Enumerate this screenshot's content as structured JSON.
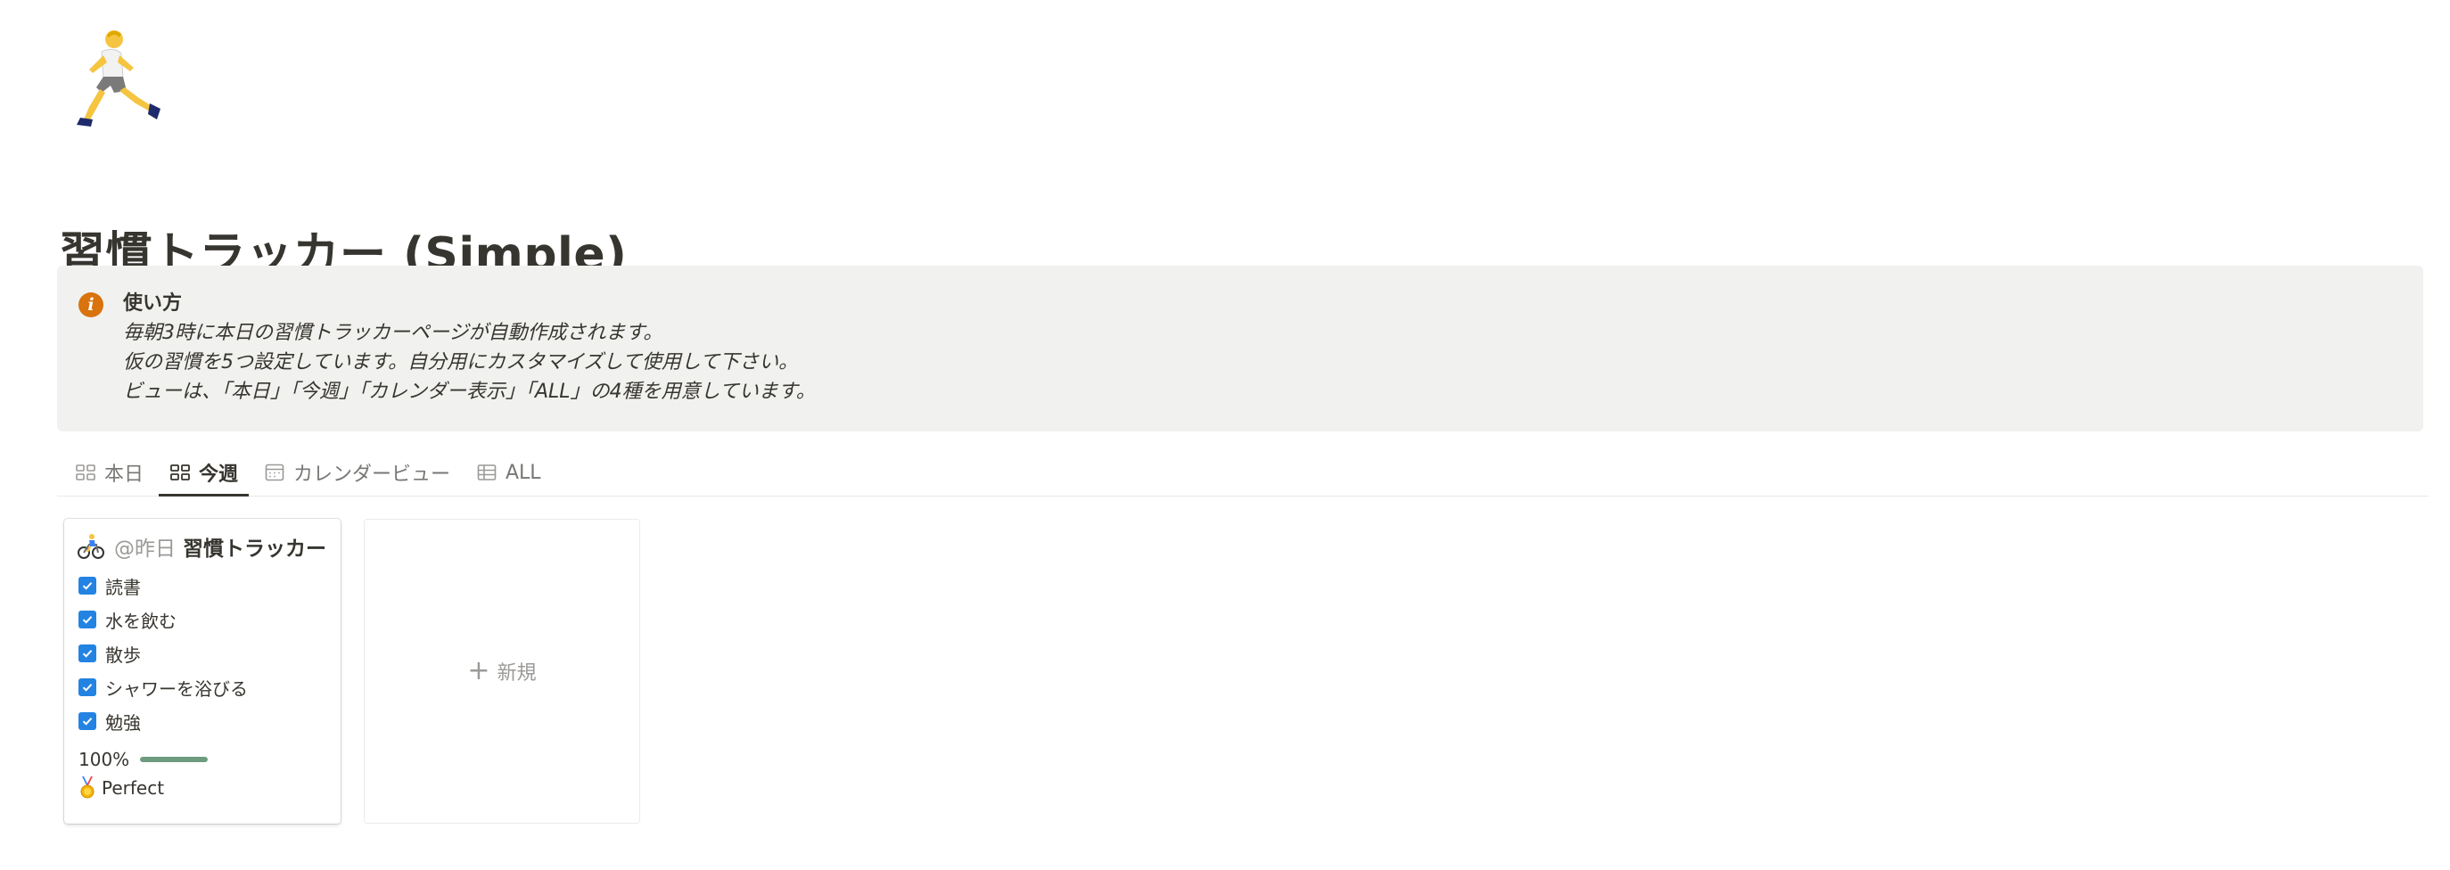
{
  "page": {
    "icon": "running-person-icon",
    "title": "習慣トラッカー (Simple)"
  },
  "callout": {
    "icon": "info-icon",
    "icon_color": "#d9730d",
    "heading": "使い方",
    "lines": [
      "毎朝3時に本日の習慣トラッカーページが自動作成されます。",
      "仮の習慣を5つ設定しています。自分用にカスタマイズして使用して下さい。",
      "ビューは、「本日」「今週」「カレンダー表示」「ALL」の4種を用意しています。"
    ]
  },
  "tabs": [
    {
      "label": "本日",
      "icon": "gallery-icon",
      "active": false
    },
    {
      "label": "今週",
      "icon": "gallery-icon",
      "active": true
    },
    {
      "label": "カレンダービュー",
      "icon": "calendar-icon",
      "active": false
    },
    {
      "label": "ALL",
      "icon": "table-icon",
      "active": false
    }
  ],
  "card": {
    "icon": "cyclist-icon",
    "mention": "@昨日",
    "title": "習慣トラッカー",
    "habits": [
      {
        "label": "読書",
        "checked": true
      },
      {
        "label": "水を飲む",
        "checked": true
      },
      {
        "label": "散歩",
        "checked": true
      },
      {
        "label": "シャワーを浴びる",
        "checked": true
      },
      {
        "label": "勉強",
        "checked": true
      }
    ],
    "progress_label": "100%",
    "progress_value": 1.0,
    "status_icon": "medal-icon",
    "status": "Perfect"
  },
  "new_card": {
    "label": "新規"
  },
  "colors": {
    "checkbox": "#2383e2",
    "progress": "#6c9b7d",
    "callout_bg": "#f1f1ef",
    "text": "#37352f",
    "muted": "#9b9a97"
  }
}
